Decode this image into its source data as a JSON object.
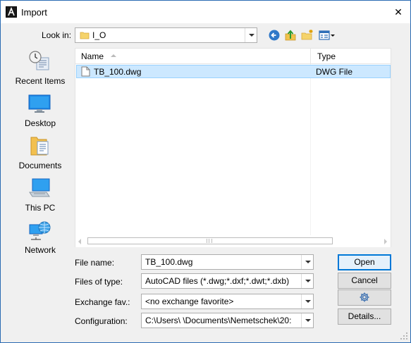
{
  "window": {
    "title": "Import",
    "close_glyph": "✕",
    "app_icon": "allplan-logo-icon"
  },
  "lookin": {
    "label": "Look in:",
    "value": "I_O",
    "toolbar_icons": [
      "back-icon",
      "up-folder-icon",
      "new-folder-icon",
      "view-menu-icon"
    ]
  },
  "places": [
    {
      "label": "Recent Items",
      "icon": "recent-items-icon"
    },
    {
      "label": "Desktop",
      "icon": "desktop-icon"
    },
    {
      "label": "Documents",
      "icon": "documents-icon"
    },
    {
      "label": "This PC",
      "icon": "this-pc-icon"
    },
    {
      "label": "Network",
      "icon": "network-icon"
    }
  ],
  "filelist": {
    "columns": [
      "Name",
      "Type"
    ],
    "rows": [
      {
        "name": "TB_100.dwg",
        "type": "DWG File",
        "selected": true
      }
    ]
  },
  "form": {
    "file_name": {
      "label": "File name:",
      "value": "TB_100.dwg"
    },
    "files_of_type": {
      "label": "Files of type:",
      "value": "AutoCAD files (*.dwg;*.dxf;*.dwt;*.dxb)"
    },
    "exchange_fav": {
      "label": "Exchange fav.:",
      "value": "<no exchange favorite>"
    },
    "configuration": {
      "label": "Configuration:",
      "value": "C:\\Users\\          \\Documents\\Nemetschek\\20:"
    }
  },
  "buttons": {
    "open": "Open",
    "cancel": "Cancel",
    "settings_icon": "gear-icon",
    "details": "Details..."
  },
  "colors": {
    "selection": "#cce8ff",
    "accent": "#0078d7",
    "dialog_bg": "#f0f0f0"
  }
}
